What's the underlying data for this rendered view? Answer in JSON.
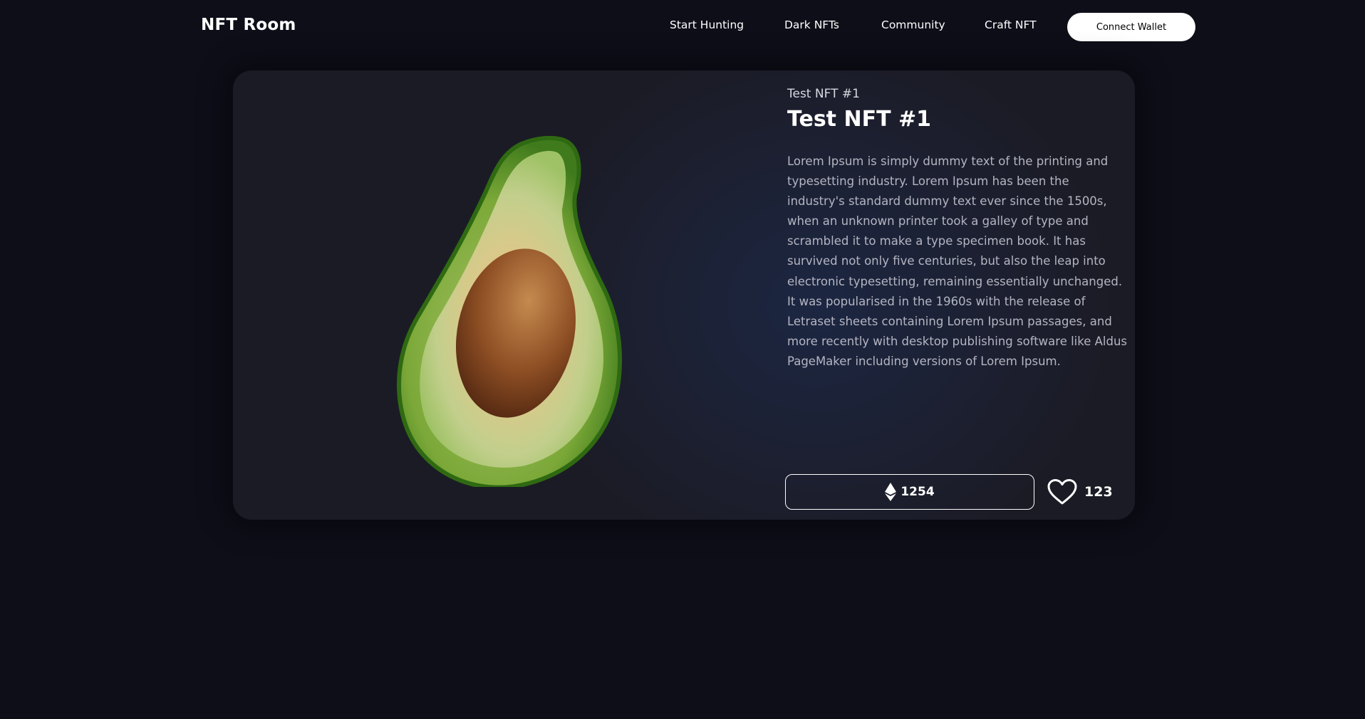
{
  "brand": "NFT Room",
  "nav": {
    "links": [
      "Start Hunting",
      "Dark NFTs",
      "Community",
      "Craft NFT"
    ],
    "connect_label": "Connect Wallet"
  },
  "nft": {
    "subtitle": "Test NFT #1",
    "title": "Test NFT #1",
    "description": "Lorem Ipsum is simply dummy text of the printing and typesetting industry. Lorem Ipsum has been the industry's standard dummy text ever since the 1500s, when an unknown printer took a galley of type and scrambled it to make a type specimen book. It has survived not only five centuries, but also the leap into electronic typesetting, remaining essentially unchanged. It was popularised in the 1960s with the release of Letraset sheets containing Lorem Ipsum passages, and more recently with desktop publishing software like Aldus PageMaker including versions of Lorem Ipsum.",
    "price": "1254",
    "likes": "123",
    "image": "avocado-half"
  },
  "icons": {
    "currency": "ethereum-icon",
    "like": "heart-icon"
  },
  "colors": {
    "background": "#0e0e19",
    "card": "#1b1b25",
    "button_bg": "#ffffff",
    "description_text": "#b4b5c2"
  }
}
